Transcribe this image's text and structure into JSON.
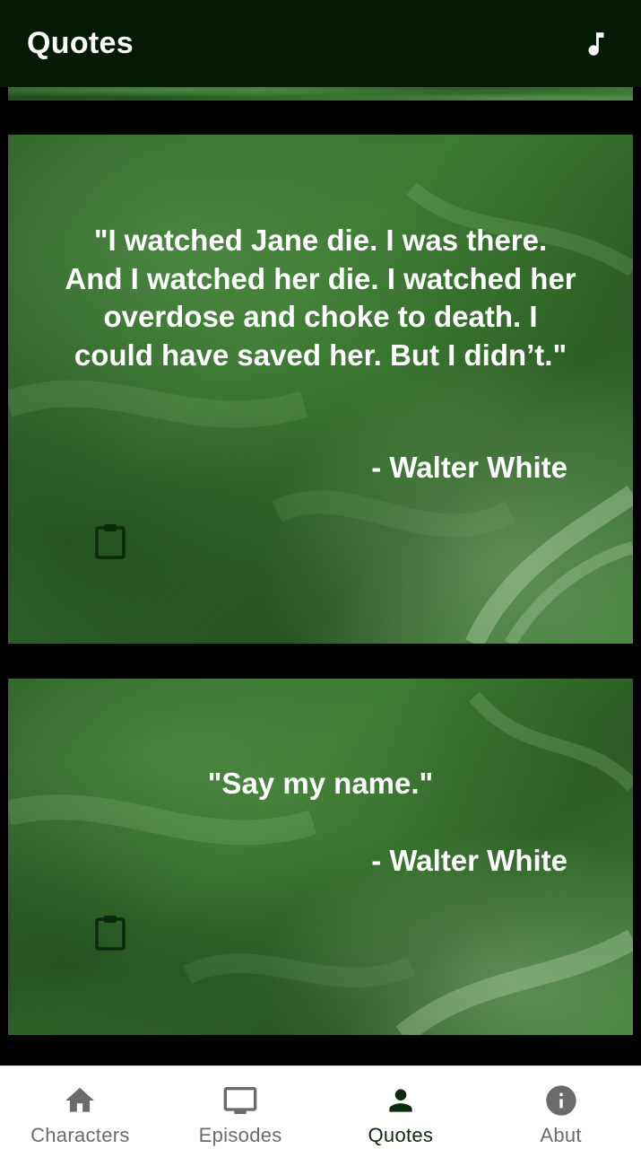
{
  "app_bar": {
    "title": "Quotes",
    "action_icon": "music-note-icon"
  },
  "quotes": [
    {
      "text": "\"I watched Jane die. I was there. And I watched her die. I watched her overdose and choke to death. I could have saved her. But I didn’t.\"",
      "author": "- Walter White",
      "copy_icon": "clipboard-icon"
    },
    {
      "text": "\"Say my name.\"",
      "author": "- Walter White",
      "copy_icon": "clipboard-icon"
    }
  ],
  "bottom_nav": {
    "items": [
      {
        "label": "Characters",
        "icon": "home-icon",
        "active": false
      },
      {
        "label": "Episodes",
        "icon": "tv-icon",
        "active": false
      },
      {
        "label": "Quotes",
        "icon": "person-icon",
        "active": true
      },
      {
        "label": "Abut",
        "icon": "info-icon",
        "active": false
      }
    ]
  },
  "colors": {
    "app_bar_bg": "#041a04",
    "card_green": "#2f6a29",
    "active_nav": "#0c2a0c",
    "inactive_nav": "#6b6b6b"
  }
}
